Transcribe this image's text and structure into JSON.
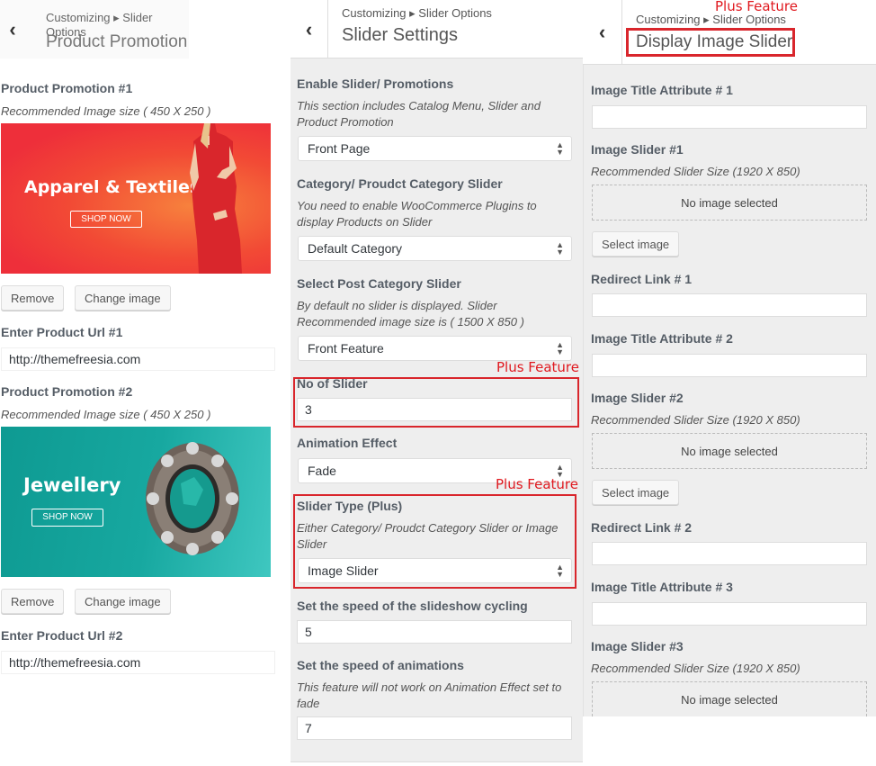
{
  "panel1": {
    "breadcrumb": "Customizing ▸ Slider Options",
    "title": "Product Promotion",
    "promotions": [
      {
        "label": "Product Promotion #1",
        "description": "Recommended Image size ( 450 X 250 )",
        "banner_text": "Apparel & Textiles",
        "banner_button": "SHOP NOW",
        "remove_label": "Remove",
        "change_label": "Change image",
        "url_label": "Enter Product Url #1",
        "url_value": "http://themefreesia.com"
      },
      {
        "label": "Product Promotion #2",
        "description": "Recommended Image size ( 450 X 250 )",
        "banner_text": "Jewellery",
        "banner_button": "SHOP NOW",
        "remove_label": "Remove",
        "change_label": "Change image",
        "url_label": "Enter Product Url #2",
        "url_value": "http://themefreesia.com"
      }
    ]
  },
  "panel2": {
    "breadcrumb": "Customizing ▸ Slider Options",
    "title": "Slider Settings",
    "enable": {
      "label": "Enable Slider/ Promotions",
      "description": "This section includes Catalog Menu, Slider and Product Promotion",
      "value": "Front Page"
    },
    "category": {
      "label": "Category/ Proudct Category Slider",
      "description": "You need to enable WooCommerce Plugins to display Products on Slider",
      "value": "Default Category"
    },
    "post_category": {
      "label": "Select Post Category Slider",
      "description": "By default no slider is displayed. Slider Recommended image size is ( 1500 X 850 )",
      "value": "Front Feature"
    },
    "plus_feature_1": "Plus Feature",
    "no_of_slider": {
      "label": "No of Slider",
      "value": "3"
    },
    "animation": {
      "label": "Animation Effect",
      "value": "Fade"
    },
    "plus_feature_2": "Plus Feature",
    "slider_type": {
      "label": "Slider Type (Plus)",
      "description": "Either Category/ Proudct Category Slider or Image Slider",
      "value": "Image Slider"
    },
    "cycle_speed": {
      "label": "Set the speed of the slideshow cycling",
      "value": "5"
    },
    "anim_speed": {
      "label": "Set the speed of animations",
      "description": "This feature will not work on Animation Effect set to fade",
      "value": "7"
    }
  },
  "panel3": {
    "plus_feature": "Plus Feature",
    "breadcrumb": "Customizing ▸ Slider Options",
    "title": "Display Image Slider",
    "slides": [
      {
        "title_label": "Image Title Attribute # 1",
        "title_value": "",
        "image_label": "Image Slider #1",
        "image_desc": "Recommended Slider Size (1920 X 850)",
        "no_image": "No image selected",
        "select_label": "Select image",
        "link_label": "Redirect Link # 1",
        "link_value": ""
      },
      {
        "title_label": "Image Title Attribute # 2",
        "title_value": "",
        "image_label": "Image Slider #2",
        "image_desc": "Recommended Slider Size (1920 X 850)",
        "no_image": "No image selected",
        "select_label": "Select image",
        "link_label": "Redirect Link # 2",
        "link_value": ""
      },
      {
        "title_label": "Image Title Attribute # 3",
        "title_value": "",
        "image_label": "Image Slider #3",
        "image_desc": "Recommended Slider Size (1920 X 850)",
        "no_image": "No image selected"
      }
    ]
  },
  "colors": {
    "plus_red": "#e0191f",
    "panel_gray": "#eeeeee",
    "banner_red": "#ee2f3a",
    "banner_teal": "#17a8a0"
  }
}
